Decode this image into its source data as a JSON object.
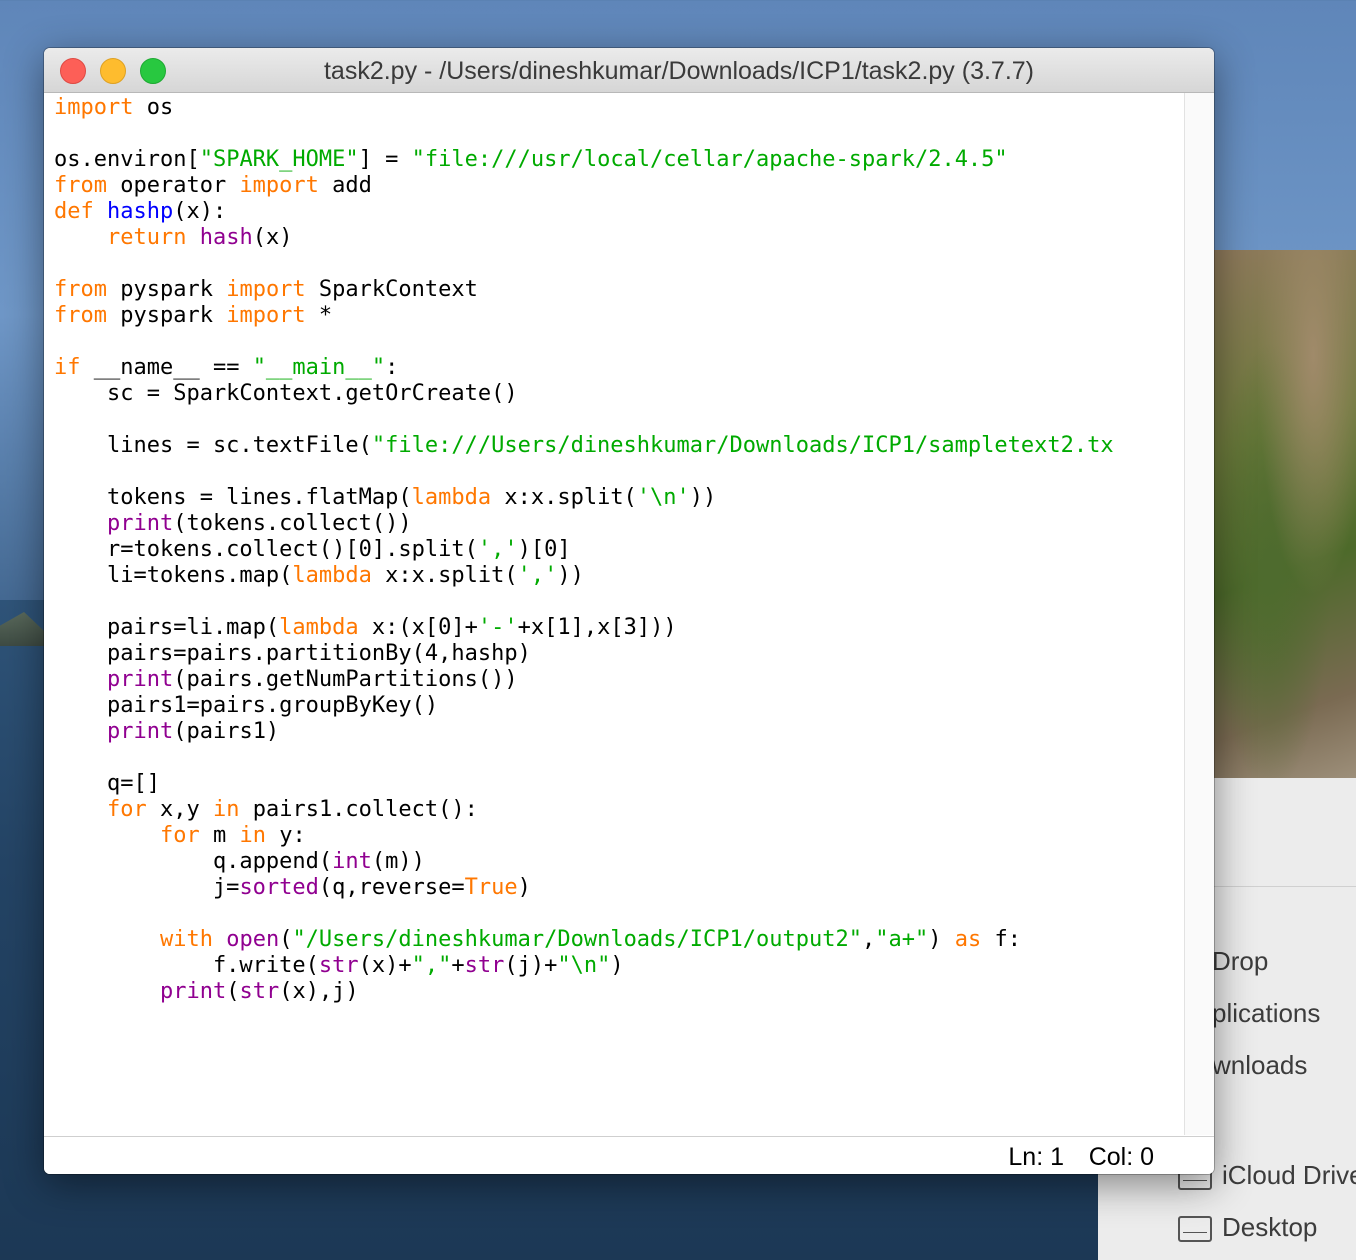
{
  "window": {
    "title": "task2.py - /Users/dineshkumar/Downloads/ICP1/task2.py (3.7.7)",
    "status_line": "Ln: 1",
    "status_col": "Col: 0"
  },
  "finder": {
    "items": [
      "Drop",
      "plications",
      "wnloads",
      "iCloud Drive",
      "Desktop"
    ]
  },
  "code": [
    [
      [
        "kw",
        "import"
      ],
      [
        "t",
        " os"
      ]
    ],
    [],
    [
      [
        "t",
        "os.environ["
      ],
      [
        "str",
        "\"SPARK_HOME\""
      ],
      [
        "t",
        "] = "
      ],
      [
        "str",
        "\"file:///usr/local/cellar/apache-spark/2.4.5\""
      ]
    ],
    [
      [
        "kw",
        "from"
      ],
      [
        "t",
        " operator "
      ],
      [
        "kw",
        "import"
      ],
      [
        "t",
        " add"
      ]
    ],
    [
      [
        "kw",
        "def"
      ],
      [
        "t",
        " "
      ],
      [
        "def",
        "hashp"
      ],
      [
        "t",
        "(x):"
      ]
    ],
    [
      [
        "t",
        "    "
      ],
      [
        "kw",
        "return"
      ],
      [
        "t",
        " "
      ],
      [
        "bi",
        "hash"
      ],
      [
        "t",
        "(x)"
      ]
    ],
    [],
    [
      [
        "kw",
        "from"
      ],
      [
        "t",
        " pyspark "
      ],
      [
        "kw",
        "import"
      ],
      [
        "t",
        " SparkContext"
      ]
    ],
    [
      [
        "kw",
        "from"
      ],
      [
        "t",
        " pyspark "
      ],
      [
        "kw",
        "import"
      ],
      [
        "t",
        " *"
      ]
    ],
    [],
    [
      [
        "kw",
        "if"
      ],
      [
        "t",
        " __name__ == "
      ],
      [
        "str",
        "\"__main__\""
      ],
      [
        "t",
        ":"
      ]
    ],
    [
      [
        "t",
        "    sc = SparkContext.getOrCreate()"
      ]
    ],
    [],
    [
      [
        "t",
        "    lines = sc.textFile("
      ],
      [
        "str",
        "\"file:///Users/dineshkumar/Downloads/ICP1/sampletext2.tx"
      ]
    ],
    [],
    [
      [
        "t",
        "    tokens = lines.flatMap("
      ],
      [
        "kw",
        "lambda"
      ],
      [
        "t",
        " x:x.split("
      ],
      [
        "str",
        "'\\n'"
      ],
      [
        "t",
        "))"
      ]
    ],
    [
      [
        "t",
        "    "
      ],
      [
        "bi",
        "print"
      ],
      [
        "t",
        "(tokens.collect())"
      ]
    ],
    [
      [
        "t",
        "    r=tokens.collect()[0].split("
      ],
      [
        "str",
        "','"
      ],
      [
        "t",
        ")[0]"
      ]
    ],
    [
      [
        "t",
        "    li=tokens.map("
      ],
      [
        "kw",
        "lambda"
      ],
      [
        "t",
        " x:x.split("
      ],
      [
        "str",
        "','"
      ],
      [
        "t",
        "))"
      ]
    ],
    [],
    [
      [
        "t",
        "    pairs=li.map("
      ],
      [
        "kw",
        "lambda"
      ],
      [
        "t",
        " x:(x[0]+"
      ],
      [
        "str",
        "'-'"
      ],
      [
        "t",
        "+x[1],x[3]))"
      ]
    ],
    [
      [
        "t",
        "    pairs=pairs.partitionBy(4,hashp)"
      ]
    ],
    [
      [
        "t",
        "    "
      ],
      [
        "bi",
        "print"
      ],
      [
        "t",
        "(pairs.getNumPartitions())"
      ]
    ],
    [
      [
        "t",
        "    pairs1=pairs.groupByKey()"
      ]
    ],
    [
      [
        "t",
        "    "
      ],
      [
        "bi",
        "print"
      ],
      [
        "t",
        "(pairs1)"
      ]
    ],
    [],
    [
      [
        "t",
        "    q=[]"
      ]
    ],
    [
      [
        "t",
        "    "
      ],
      [
        "kw",
        "for"
      ],
      [
        "t",
        " x,y "
      ],
      [
        "kw",
        "in"
      ],
      [
        "t",
        " pairs1.collect():"
      ]
    ],
    [
      [
        "t",
        "        "
      ],
      [
        "kw",
        "for"
      ],
      [
        "t",
        " m "
      ],
      [
        "kw",
        "in"
      ],
      [
        "t",
        " y:"
      ]
    ],
    [
      [
        "t",
        "            q.append("
      ],
      [
        "bi",
        "int"
      ],
      [
        "t",
        "(m))"
      ]
    ],
    [
      [
        "t",
        "            j="
      ],
      [
        "bi",
        "sorted"
      ],
      [
        "t",
        "(q,reverse="
      ],
      [
        "kw",
        "True"
      ],
      [
        "t",
        ")"
      ]
    ],
    [],
    [
      [
        "t",
        "        "
      ],
      [
        "kw",
        "with"
      ],
      [
        "t",
        " "
      ],
      [
        "bi",
        "open"
      ],
      [
        "t",
        "("
      ],
      [
        "str",
        "\"/Users/dineshkumar/Downloads/ICP1/output2\""
      ],
      [
        "t",
        ","
      ],
      [
        "str",
        "\"a+\""
      ],
      [
        "t",
        ") "
      ],
      [
        "kw",
        "as"
      ],
      [
        "t",
        " f:"
      ]
    ],
    [
      [
        "t",
        "            f.write("
      ],
      [
        "bi",
        "str"
      ],
      [
        "t",
        "(x)+"
      ],
      [
        "str",
        "\",\""
      ],
      [
        "t",
        "+"
      ],
      [
        "bi",
        "str"
      ],
      [
        "t",
        "(j)+"
      ],
      [
        "str",
        "\"\\n\""
      ],
      [
        "t",
        ")"
      ]
    ],
    [
      [
        "t",
        "        "
      ],
      [
        "bi",
        "print"
      ],
      [
        "t",
        "("
      ],
      [
        "bi",
        "str"
      ],
      [
        "t",
        "(x),j)"
      ]
    ]
  ]
}
